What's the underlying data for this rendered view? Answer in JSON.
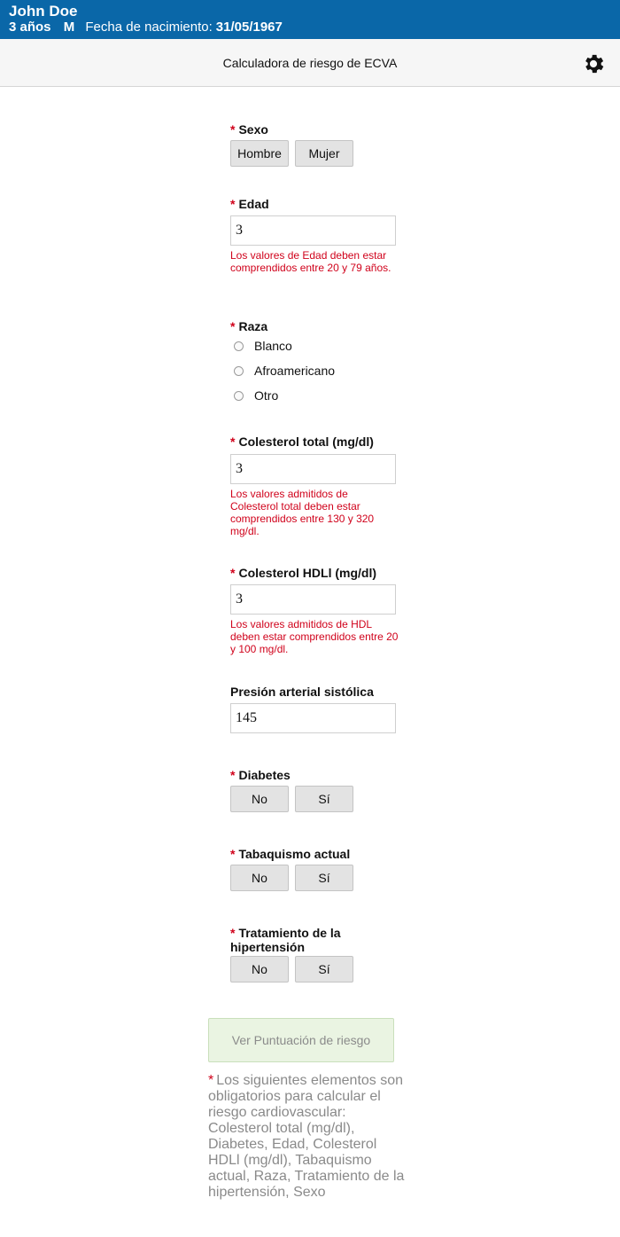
{
  "patient": {
    "name": "John Doe",
    "age": "3 años",
    "sex": "M",
    "dob_label": "Fecha de nacimiento:",
    "dob": "31/05/1967"
  },
  "header": {
    "title": "Calculadora de riesgo de ECVA",
    "settings_icon": "gear-icon"
  },
  "required_mark": "*",
  "sexo": {
    "label": "Sexo",
    "options": [
      "Hombre",
      "Mujer"
    ]
  },
  "edad": {
    "label": "Edad",
    "value": "3",
    "error": "Los valores de Edad deben estar comprendidos entre 20 y 79 años."
  },
  "raza": {
    "label": "Raza",
    "options": [
      "Blanco",
      "Afroamericano",
      "Otro"
    ]
  },
  "colesterol_total": {
    "label": "Colesterol total (mg/dl)",
    "value": "3",
    "error": "Los valores admitidos de Colesterol total deben estar comprendidos entre 130 y 320 mg/dl."
  },
  "colesterol_hdl": {
    "label": "Colesterol HDLl (mg/dl)",
    "value": "3",
    "error": "Los valores admitidos de HDL deben estar comprendidos entre 20 y 100 mg/dl."
  },
  "presion": {
    "label": "Presión arterial sistólica",
    "value": "145"
  },
  "diabetes": {
    "label": "Diabetes",
    "options": [
      "No",
      "Sí"
    ]
  },
  "tabaquismo": {
    "label": "Tabaquismo actual",
    "options": [
      "No",
      "Sí"
    ]
  },
  "tratamiento": {
    "label": "Tratamiento de la hipertensión",
    "options": [
      "No",
      "Sí"
    ]
  },
  "submit_label": "Ver Puntuación de riesgo",
  "footnote": "Los siguientes elementos son obligatorios para calcular el riesgo cardiovascular: Colesterol total (mg/dl), Diabetes, Edad, Colesterol HDLl (mg/dl), Tabaquismo actual, Raza, Tratamiento de la hipertensión, Sexo"
}
